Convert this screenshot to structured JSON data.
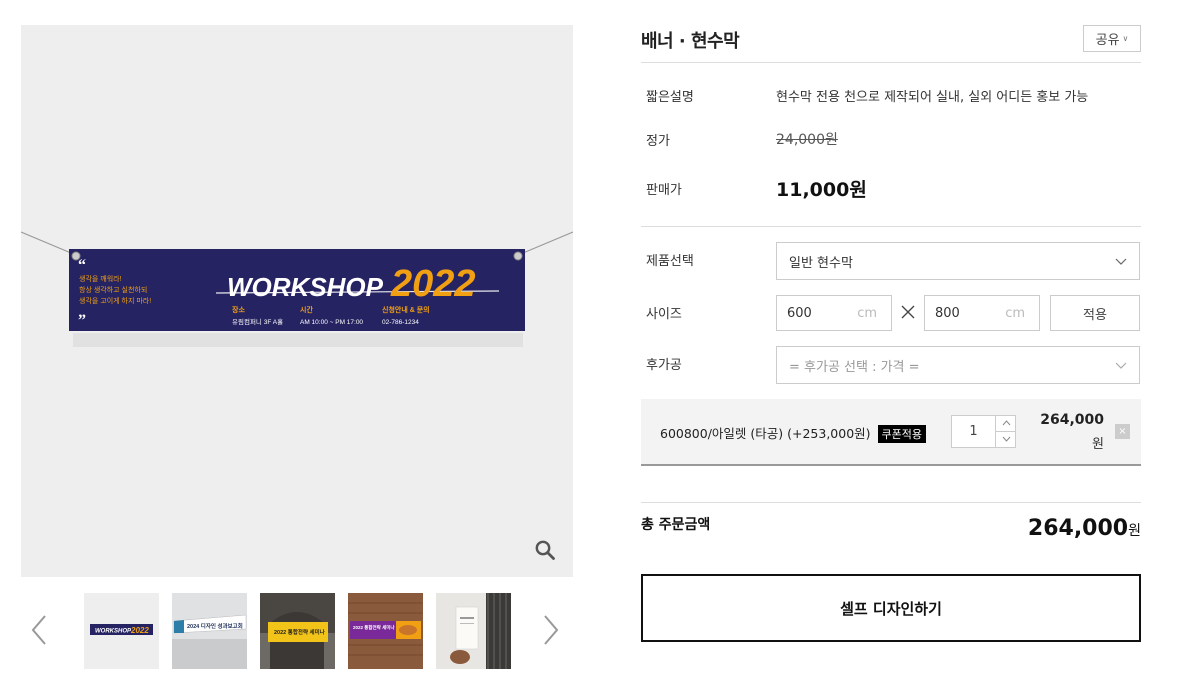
{
  "product": {
    "title": "배너 · 현수막",
    "share_label": "공유"
  },
  "gallery": {
    "banner": {
      "quote_lines": [
        "생각을 깨워라!",
        "항상 생각하고 실천하되",
        "생각을 고이게 하지 마라!"
      ],
      "headline": "WORKSHOP",
      "year": "2022",
      "place_label": "장소",
      "place_value": "유림컴퍼니 3F A홀",
      "time_label": "시간",
      "time_value": "AM 10:00 ~ PM 17:00",
      "contact_label": "신청안내 & 문의",
      "contact_value": "02-786-1234"
    },
    "thumbnails": [
      {
        "name": "thumb-workshop",
        "text": "WORKSHOP 2022"
      },
      {
        "name": "thumb-design-seminar",
        "text": "2024 디자인 성과보고회"
      },
      {
        "name": "thumb-yellow-seminar",
        "text": "2022 통합전략 세미나"
      },
      {
        "name": "thumb-food-banner",
        "text": "2022 통합전략 세미나"
      },
      {
        "name": "thumb-standing-banner",
        "text": ""
      }
    ]
  },
  "details": {
    "summary_label": "짧은설명",
    "summary_value": "현수막 전용 천으로 제작되어 실내, 실외 어디든 홍보 가능",
    "list_price_label": "정가",
    "list_price_value": "24,000원",
    "sale_price_label": "판매가",
    "sale_price_value": "11,000원"
  },
  "options": {
    "product_select_label": "제품선택",
    "product_select_value": "일반 현수막",
    "size_label": "사이즈",
    "width_value": "600",
    "height_value": "800",
    "unit": "cm",
    "apply_label": "적용",
    "post_process_label": "후가공",
    "post_process_placeholder": "= 후가공 선택 : 가격 ="
  },
  "selected_option": {
    "name": "600800/아일렛 (타공) (+253,000원)",
    "coupon_label": "쿠폰적용",
    "quantity": "1",
    "price": "264,000",
    "price_unit": "원",
    "remove_label": "×"
  },
  "total": {
    "label": "총 주문금액",
    "value": "264,000",
    "unit": "원"
  },
  "cta": {
    "design_button": "셀프 디자인하기"
  },
  "colors": {
    "banner_navy": "#262363",
    "banner_orange": "#f0a012",
    "coupon_bg": "#000000"
  }
}
